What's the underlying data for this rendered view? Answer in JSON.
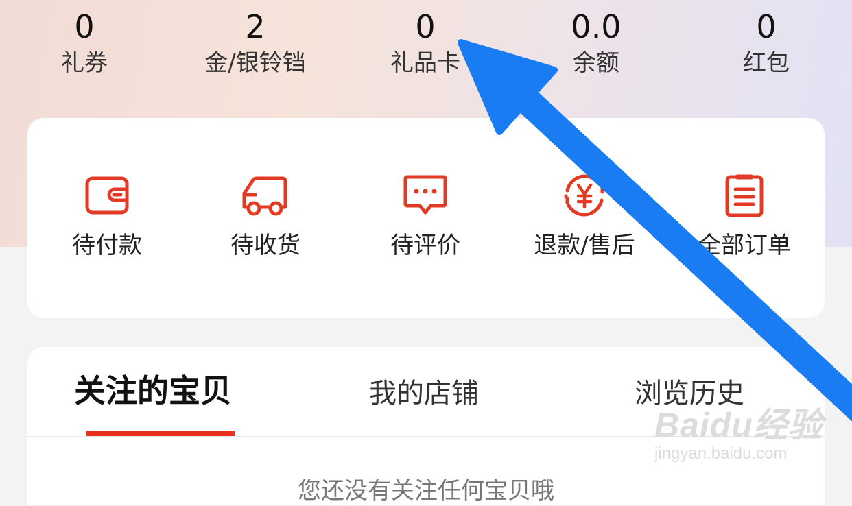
{
  "stats": [
    {
      "value": "0",
      "label": "礼券"
    },
    {
      "value": "2",
      "label": "金/银铃铛"
    },
    {
      "value": "0",
      "label": "礼品卡"
    },
    {
      "value": "0.0",
      "label": "余额"
    },
    {
      "value": "0",
      "label": "红包"
    }
  ],
  "orders": [
    {
      "label": "待付款",
      "icon": "wallet-icon"
    },
    {
      "label": "待收货",
      "icon": "delivery-truck-icon"
    },
    {
      "label": "待评价",
      "icon": "comment-bubble-icon"
    },
    {
      "label": "退款/售后",
      "icon": "refund-yen-icon"
    },
    {
      "label": "全部订单",
      "icon": "clipboard-list-icon"
    }
  ],
  "tabs": {
    "items": [
      "关注的宝贝",
      "我的店铺",
      "浏览历史"
    ],
    "active": "关注的宝贝"
  },
  "empty_state": "您还没有关注任何宝贝哦",
  "watermark": {
    "logo": "Baidu经验",
    "url": "jingyan.baidu.com"
  },
  "colors": {
    "accent": "#e8321e",
    "icon": "#e23a24",
    "annotation_arrow": "#1a7cf2"
  }
}
